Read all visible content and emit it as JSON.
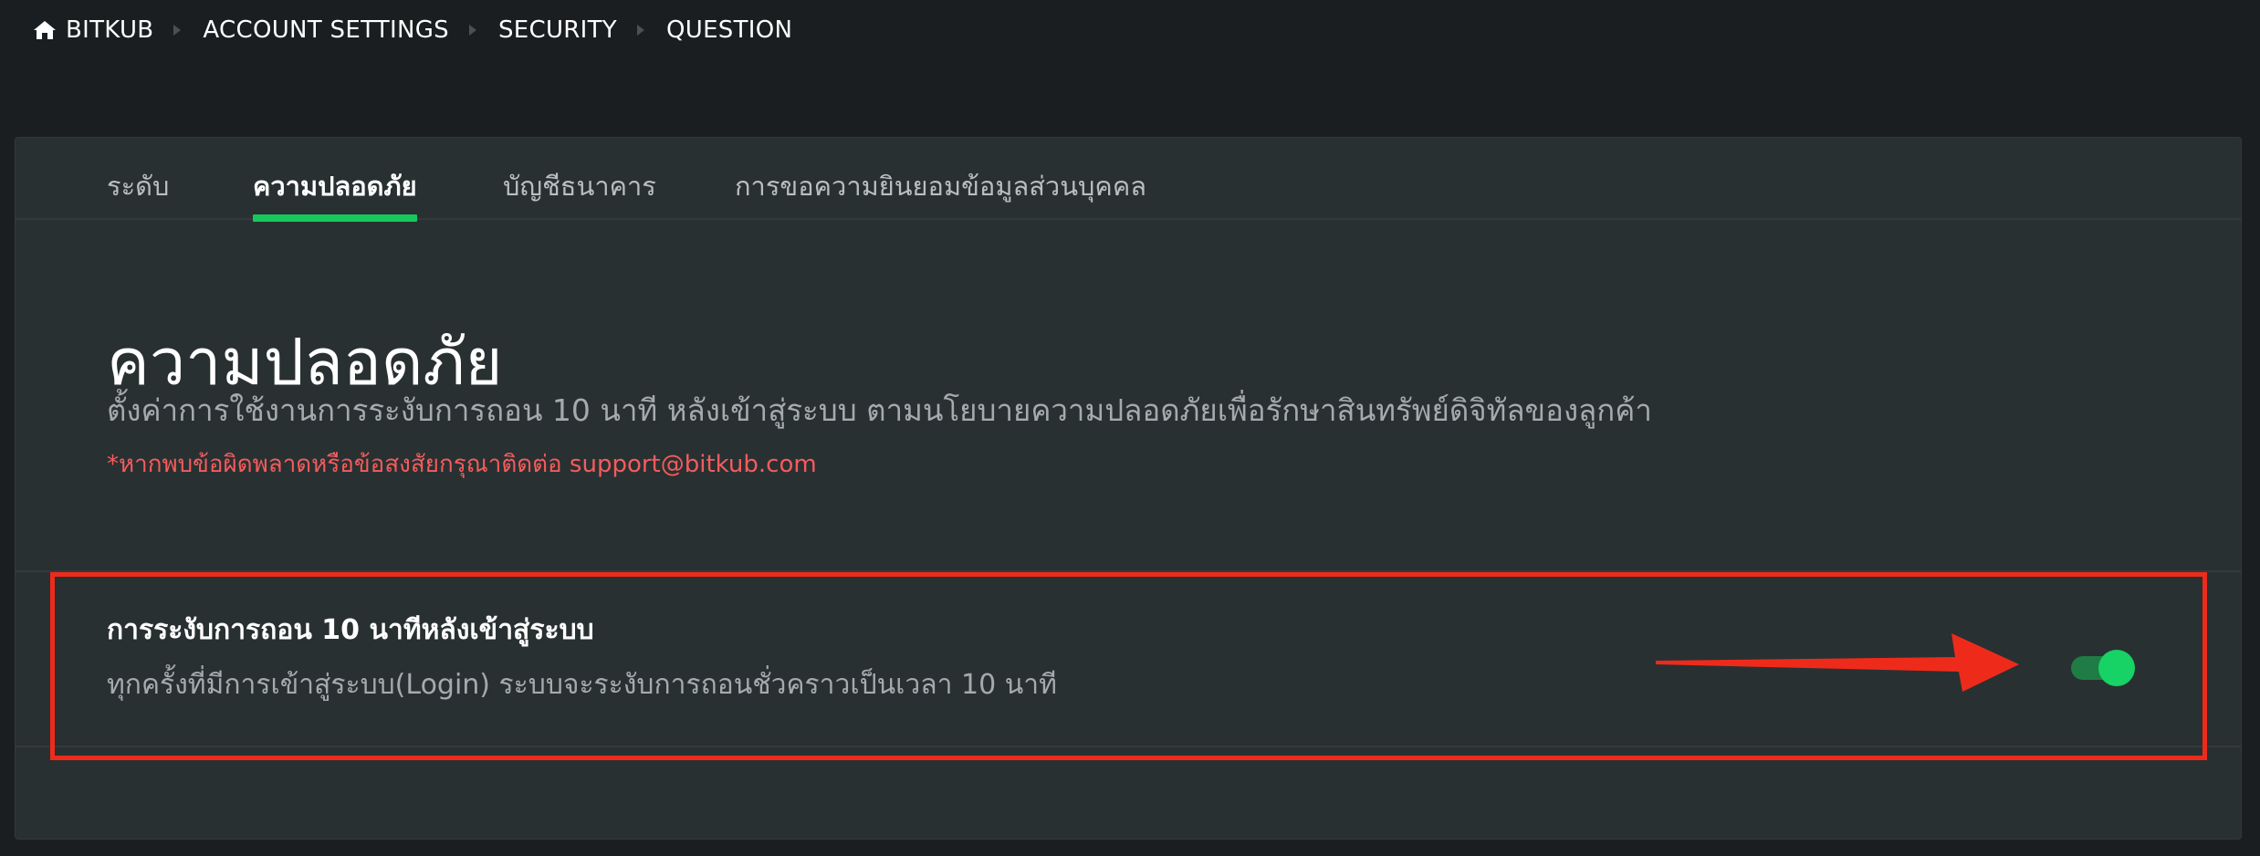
{
  "breadcrumb": {
    "items": [
      "BITKUB",
      "ACCOUNT SETTINGS",
      "SECURITY",
      "QUESTION"
    ]
  },
  "tabs": [
    {
      "label": "ระดับ",
      "active": false
    },
    {
      "label": "ความปลอดภัย",
      "active": true
    },
    {
      "label": "บัญชีธนาคาร",
      "active": false
    },
    {
      "label": "การขอความยินยอมข้อมูลส่วนบุคคล",
      "active": false
    }
  ],
  "section": {
    "title": "ความปลอดภัย",
    "subtitle": "ตั้งค่าการใช้งานการระงับการถอน 10 นาที หลังเข้าสู่ระบบ ตามนโยบายความปลอดภัยเพื่อรักษาสินทรัพย์ดิจิทัลของลูกค้า",
    "note": "*หากพบข้อผิดพลาดหรือข้อสงสัยกรุณาติดต่อ support@bitkub.com"
  },
  "setting": {
    "title": "การระงับการถอน 10 นาทีหลังเข้าสู่ระบบ",
    "description": "ทุกครั้งที่มีการเข้าสู่ระบบ(Login) ระบบจะระงับการถอนชั่วคราวเป็นเวลา 10 นาที",
    "enabled": true
  },
  "icons": {
    "home": "home-icon",
    "separator": "chevron-right-icon"
  },
  "colors": {
    "accent": "#16c85c",
    "note": "#f45c5c",
    "annotation": "#ee2b1b",
    "background": "#1b1e20",
    "card": "#293032"
  }
}
